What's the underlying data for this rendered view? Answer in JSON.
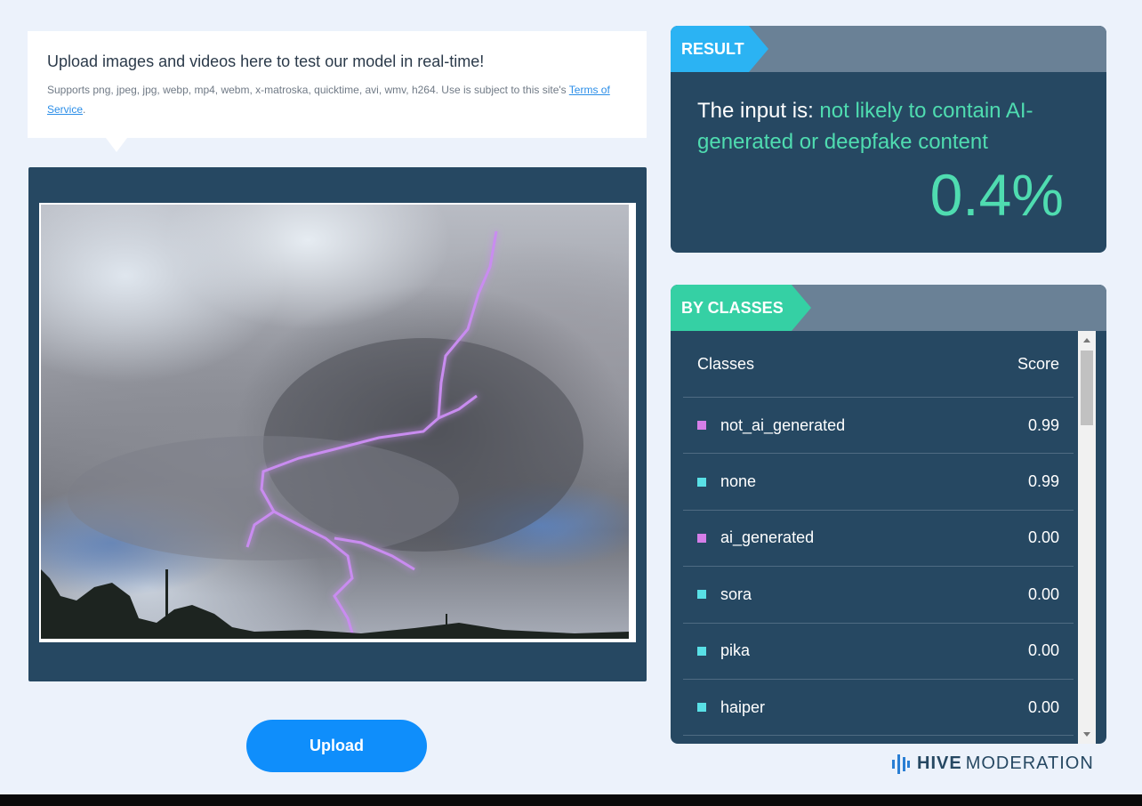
{
  "upload_card": {
    "title": "Upload images and videos here to test our model in real-time!",
    "description": "Supports png, jpeg, jpg, webp, mp4, webm, x-matroska, quicktime, avi, wmv, h264. Use is subject to this site's",
    "terms_link": "Terms of Service",
    "terms_suffix": "."
  },
  "upload_button": {
    "label": "Upload"
  },
  "result": {
    "tag": "RESULT",
    "prefix": "The input is:",
    "verdict": "not likely to contain AI-generated or deepfake content",
    "percentage": "0.4%"
  },
  "classes": {
    "tag": "BY CLASSES",
    "header": {
      "classes": "Classes",
      "score": "Score"
    },
    "rows": [
      {
        "name": "not_ai_generated",
        "score": "0.99",
        "color": "#d57ee8"
      },
      {
        "name": "none",
        "score": "0.99",
        "color": "#59e0e6"
      },
      {
        "name": "ai_generated",
        "score": "0.00",
        "color": "#d57ee8"
      },
      {
        "name": "sora",
        "score": "0.00",
        "color": "#59e0e6"
      },
      {
        "name": "pika",
        "score": "0.00",
        "color": "#59e0e6"
      },
      {
        "name": "haiper",
        "score": "0.00",
        "color": "#59e0e6"
      }
    ]
  },
  "brand": {
    "strong": "HIVE",
    "light": "MODERATION",
    "icon": "hive-bars-icon"
  },
  "colors": {
    "panel": "#264862",
    "accent_blue": "#2bb3f3",
    "accent_green": "#35d0a4",
    "button": "#0f8efb"
  }
}
